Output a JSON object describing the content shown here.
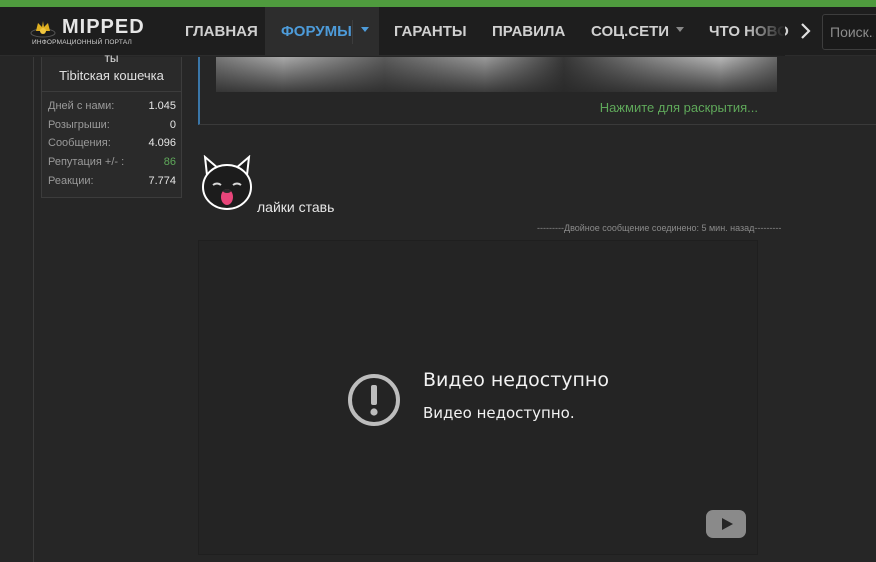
{
  "brand": {
    "title": "MIPPED",
    "subtitle": "ИНФОРМАЦИОННЫЙ ПОРТАЛ"
  },
  "nav": {
    "items": [
      {
        "label": "ГЛАВНАЯ"
      },
      {
        "label": "ФОРУМЫ",
        "active": true
      },
      {
        "label": "ГАРАНТЫ"
      },
      {
        "label": "ПРАВИЛА"
      },
      {
        "label": "СОЦ.СЕТИ"
      },
      {
        "label": "ЧТО НОВО"
      }
    ],
    "next_icon": "chevron-right-icon",
    "search_placeholder": "Поиск..."
  },
  "user_card": {
    "name_fragment": "ты",
    "title": "Tibitская кошечка",
    "stats": [
      {
        "label": "Дней с нами:",
        "value": "1.045"
      },
      {
        "label": "Розыгрыши:",
        "value": "0"
      },
      {
        "label": "Сообщения:",
        "value": "4.096"
      },
      {
        "label": "Репутация +/- :",
        "value": "86"
      },
      {
        "label": "Реакции:",
        "value": "7.774"
      }
    ]
  },
  "quote": {
    "expand_label": "Нажмите для раскрытия..."
  },
  "post": {
    "sticker_icon": "black-cat-sticker-icon",
    "text": "лайки ставь",
    "merge_note": "---------Двойное сообщение соединено: 5 мин. назад---------"
  },
  "video": {
    "heading": "Видео недоступно",
    "subtext": "Видео недоступно.",
    "warning_icon": "exclamation-circle-icon",
    "player_icon": "youtube-icon"
  },
  "colors": {
    "accent_green": "#4f9b3e",
    "active_blue": "#4d9bd9",
    "reputation_green": "#5fa85a",
    "quote_border": "#3a76a8"
  }
}
